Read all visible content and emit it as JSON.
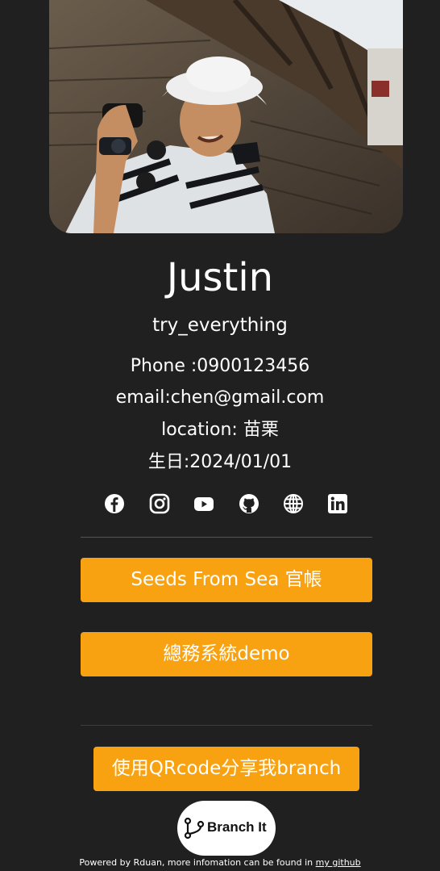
{
  "profile": {
    "name": "Justin",
    "tagline": "try_everything",
    "phone": "Phone :0900123456",
    "email": "email:chen@gmail.com",
    "location": "location: 苗栗",
    "birthday": "生日:2024/01/01"
  },
  "socials": [
    {
      "icon": "facebook-icon"
    },
    {
      "icon": "instagram-icon"
    },
    {
      "icon": "youtube-icon"
    },
    {
      "icon": "github-icon"
    },
    {
      "icon": "website-icon"
    },
    {
      "icon": "linkedin-icon"
    }
  ],
  "links": [
    {
      "label": "Seeds From Sea 官帳"
    },
    {
      "label": "總務系統demo"
    }
  ],
  "share_button": {
    "label": "使用QRcode分享我branch"
  },
  "branding": {
    "logo_text": "Branch It"
  },
  "footer": {
    "text": "Powered by Rduan, more infomation can be found in ",
    "link_label": "my github"
  },
  "colors": {
    "background": "#202020",
    "accent": "#f9a211",
    "divider_top": "#5e5530",
    "divider_bottom": "#3d3d3d",
    "text": "#ffffff"
  }
}
